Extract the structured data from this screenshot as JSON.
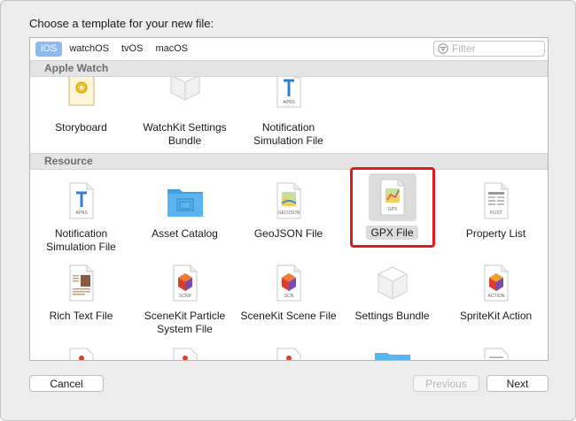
{
  "dialog": {
    "title": "Choose a template for your new file:"
  },
  "platforms": [
    "iOS",
    "watchOS",
    "tvOS",
    "macOS"
  ],
  "selected_platform": "iOS",
  "filter": {
    "placeholder": "Filter",
    "value": ""
  },
  "sections": {
    "apple_watch": "Apple Watch",
    "resource": "Resource"
  },
  "apple_watch_items": [
    {
      "label": "Storyboard",
      "icon": "storyboard-icon"
    },
    {
      "label": "WatchKit Settings Bundle",
      "icon": "settings-bundle-icon"
    },
    {
      "label": "Notification Simulation File",
      "icon": "apns-file-icon",
      "icon_text": "APNS"
    }
  ],
  "resource_items_row1": [
    {
      "label": "Notification Simulation File",
      "icon": "apns-file-icon",
      "icon_text": "APNS"
    },
    {
      "label": "Asset Catalog",
      "icon": "folder-icon"
    },
    {
      "label": "GeoJSON File",
      "icon": "geojson-file-icon",
      "icon_text": "GEOJSON"
    },
    {
      "label": "GPX File",
      "icon": "gpx-file-icon",
      "icon_text": "GPX",
      "selected": true
    },
    {
      "label": "Property List",
      "icon": "plist-file-icon",
      "icon_text": "PLIST"
    }
  ],
  "resource_items_row2": [
    {
      "label": "Rich Text File",
      "icon": "rich-text-file-icon"
    },
    {
      "label": "SceneKit Particle System File",
      "icon": "scnp-file-icon",
      "icon_text": "SCNP"
    },
    {
      "label": "SceneKit Scene File",
      "icon": "scn-file-icon",
      "icon_text": "SCN"
    },
    {
      "label": "Settings Bundle",
      "icon": "settings-bundle-icon"
    },
    {
      "label": "SpriteKit Action",
      "icon": "action-file-icon",
      "icon_text": "ACTION"
    }
  ],
  "buttons": {
    "cancel": "Cancel",
    "previous": "Previous",
    "next": "Next"
  },
  "colors": {
    "selection_highlight": "#e11b1b",
    "selected_tab": "#8fb8ef",
    "folder_blue": "#4aa8e6"
  }
}
